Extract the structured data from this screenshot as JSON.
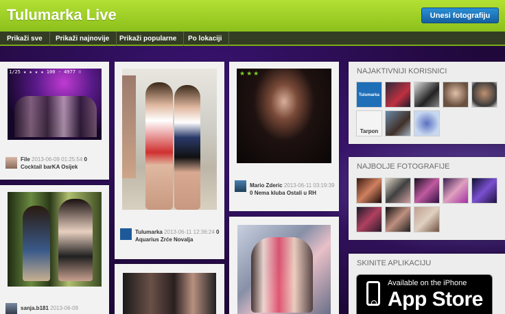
{
  "header": {
    "title": "Tulumarka Live",
    "upload_button": "Unesi fotografiju"
  },
  "nav": {
    "items": [
      "Prikaži sve",
      "Prikaži najnovije",
      "Prikaži popularne",
      "Po lokaciji"
    ]
  },
  "feed": {
    "cards": [
      {
        "user": "File",
        "time": "2013-06-09 01:25:54",
        "count": "0",
        "club": "Cocktail barKA Osijek",
        "camera_text": "1/25 ★ ★ ★ ★ 100 - 4977 ∷"
      },
      {
        "user": "Tulumarka",
        "time": "2013-06-11 12:36:24",
        "count": "0",
        "club": "Aquarius Zrće Novalja"
      },
      {
        "user": "Mario Zderic",
        "time": "2013-06-11 03:19:39",
        "count": "0",
        "club": "Nema kluba Ostali u RH"
      },
      {
        "user": "sanja.b181",
        "time": "2013-06-09",
        "count": "",
        "club": ""
      }
    ]
  },
  "sidebar": {
    "active_users_title": "NAJAKTIVNIJI KORISNICI",
    "best_photos_title": "NAJBOLJE FOTOGRAFIJE",
    "app_title": "SKINITE APLIKACIJU",
    "user_thumb_labels": [
      "Tulumarka",
      "Tarpon"
    ],
    "app_store": {
      "line1": "Available on the iPhone",
      "line2": "App Store"
    }
  },
  "colors": {
    "header_green": "#8cc01c",
    "nav_dark": "#333d24",
    "upload_blue": "#1f78bf",
    "background_purple": "#22093f"
  }
}
